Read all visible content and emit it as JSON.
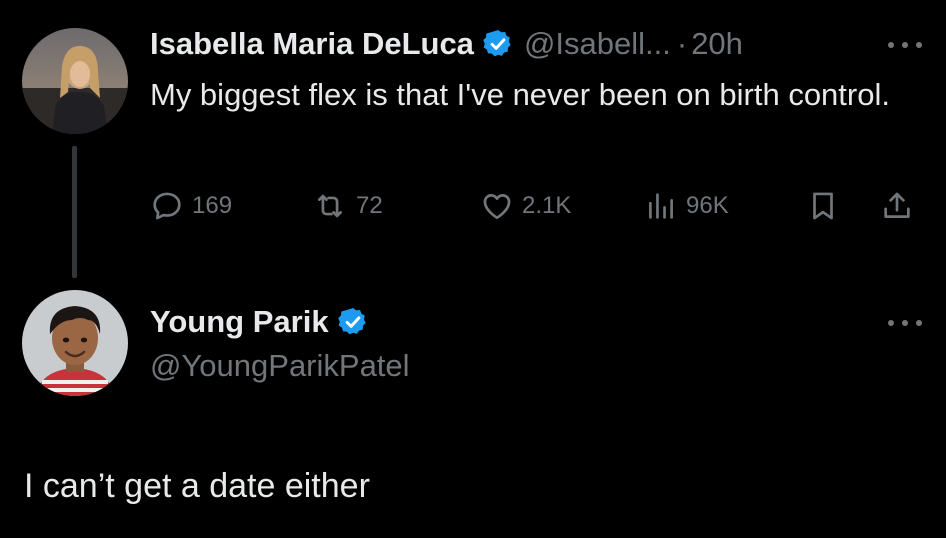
{
  "original_tweet": {
    "author_name": "Isabella Maria DeLuca",
    "handle": "@Isabell...",
    "separator": "·",
    "time": "20h",
    "text": "My biggest flex is that I've never been on birth control.",
    "avatar_icon": "person-photo-avatar",
    "stats": {
      "replies": "169",
      "retweets": "72",
      "likes": "2.1K",
      "views": "96K"
    }
  },
  "reply_tweet": {
    "author_name": "Young Parik",
    "handle": "@YoungParikPatel",
    "text": "I can’t get a date either",
    "avatar_icon": "person-photo-avatar"
  },
  "colors": {
    "background": "#000000",
    "primary_text": "#e7e9ea",
    "secondary_text": "#71767b",
    "verified_blue": "#1d9bf0",
    "thread_line": "#333639"
  }
}
